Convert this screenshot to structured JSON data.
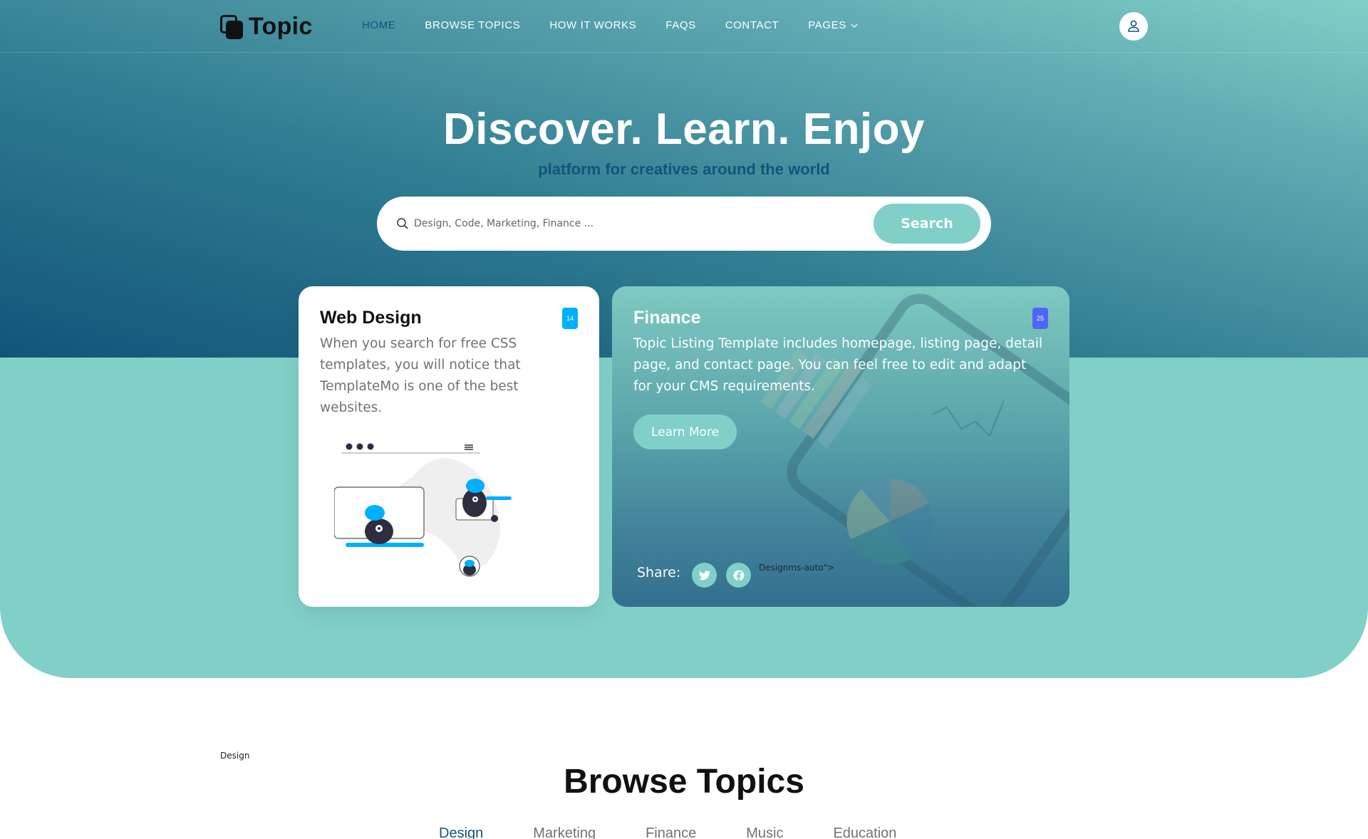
{
  "brand": {
    "name": "Topic",
    "icon": "layered-squares-icon"
  },
  "nav": {
    "items": [
      {
        "label": "Home",
        "active": true
      },
      {
        "label": "Browse Topics",
        "active": false
      },
      {
        "label": "How it works",
        "active": false
      },
      {
        "label": "FAQs",
        "active": false
      },
      {
        "label": "Contact",
        "active": false
      },
      {
        "label": "Pages",
        "active": false,
        "dropdown": true
      }
    ],
    "user_icon": "person-icon"
  },
  "hero": {
    "title": "Discover. Learn. Enjoy",
    "subtitle": "platform for creatives around the world",
    "search": {
      "placeholder": "Design, Code, Marketing, Finance ...",
      "value": "",
      "button_label": "Search",
      "icon": "search-icon"
    }
  },
  "cards": [
    {
      "title": "Web Design",
      "text": "When you search for free CSS templates, you will notice that TemplateMo is one of the best websites.",
      "badge": "14",
      "badge_color": "#00b0ff"
    },
    {
      "title": "Finance",
      "text": "Topic Listing Template includes homepage, listing page, detail page, and contact page. You can feel free to edit and adapt for your CMS requirements.",
      "badge": "25",
      "badge_color": "#5066f5",
      "button_label": "Learn More",
      "share_label": "Share:",
      "social": [
        "twitter-icon",
        "facebook-icon"
      ],
      "stray_text": "Designms-auto\">"
    }
  ],
  "browse": {
    "stray_label": "Design",
    "title": "Browse Topics",
    "tabs": [
      {
        "label": "Design",
        "active": true
      },
      {
        "label": "Marketing",
        "active": false
      },
      {
        "label": "Finance",
        "active": false
      },
      {
        "label": "Music",
        "active": false
      },
      {
        "label": "Education",
        "active": false
      }
    ]
  },
  "colors": {
    "primary": "#13547a",
    "secondary": "#80d0c7",
    "white": "#ffffff",
    "text_muted": "#717275"
  }
}
